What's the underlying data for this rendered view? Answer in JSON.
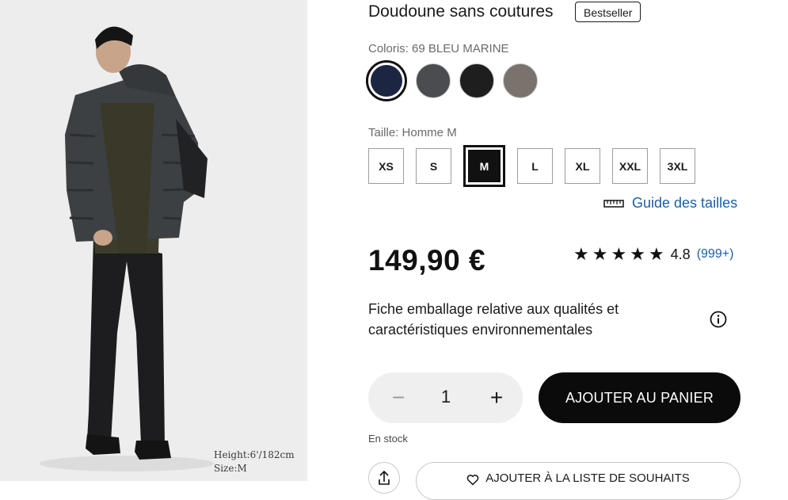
{
  "product": {
    "title": "Doudoune sans coutures",
    "badge": "Bestseller",
    "photo_caption": {
      "height": "Height:6'/182cm",
      "size": "Size:M"
    }
  },
  "color": {
    "label": "Coloris: 69 BLEU MARINE",
    "swatches": [
      {
        "name": "navy",
        "hex": "#1c2541",
        "selected": true
      },
      {
        "name": "dark-gray",
        "hex": "#4a4c4f",
        "selected": false
      },
      {
        "name": "black",
        "hex": "#1e1e1e",
        "selected": false
      },
      {
        "name": "gray-brown",
        "hex": "#7a736d",
        "selected": false
      }
    ]
  },
  "size": {
    "label": "Taille: Homme M",
    "options": [
      "XS",
      "S",
      "M",
      "L",
      "XL",
      "XXL",
      "3XL"
    ],
    "selected": "M",
    "guide_label": "Guide des tailles"
  },
  "price": {
    "value": "149,90 €"
  },
  "rating": {
    "stars": 5,
    "value": "4.8",
    "count": "(999+)"
  },
  "fiche": {
    "text": "Fiche emballage relative aux qualités et caractéristiques environnementales"
  },
  "quantity": {
    "value": "1",
    "minus": "−",
    "plus": "+"
  },
  "actions": {
    "add_to_cart": "AJOUTER AU PANIER",
    "wishlist": "AJOUTER À LA LISTE DE SOUHAITS"
  },
  "stock": {
    "status": "En stock"
  },
  "icons": {
    "ruler": "ruler-icon",
    "info": "info-icon",
    "share": "share-icon",
    "heart": "heart-icon",
    "star": "star-icon"
  }
}
